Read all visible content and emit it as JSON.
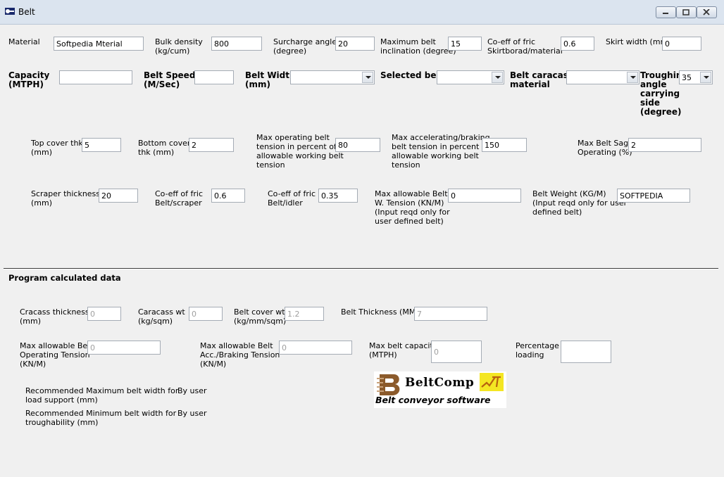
{
  "window": {
    "title": "Belt"
  },
  "row1": {
    "material": {
      "label": "Material",
      "value": "Softpedia Mterial"
    },
    "bulk_density": {
      "label": "Bulk density\n(kg/cum)",
      "value": "800"
    },
    "surcharge_angle": {
      "label": "Surcharge angle\n(degree)",
      "value": "20"
    },
    "max_belt_inclination": {
      "label": "Maximum belt\ninclination (degree)",
      "value": "15"
    },
    "coeff_fric_skirtboard": {
      "label": "Co-eff of fric\nSkirtborad/material",
      "value": "0.6"
    },
    "skirt_width": {
      "label": "Skirt width (mm)",
      "value": "0"
    }
  },
  "row2": {
    "capacity": {
      "label": "Capacity\n(MTPH)",
      "value": ""
    },
    "belt_speed": {
      "label": "Belt Speed\n(M/Sec)",
      "value": ""
    },
    "belt_width": {
      "label": "Belt Width\n(mm)",
      "value": ""
    },
    "selected_belt": {
      "label": "Selected belt",
      "value": ""
    },
    "belt_carcass": {
      "label": "Belt caracass\nmaterial",
      "value": ""
    },
    "troughing_angle": {
      "label": "Troughin\nangle\ncarrying\nside\n(degree)",
      "value": "35"
    }
  },
  "row3": {
    "top_cover": {
      "label": "Top cover thk\n(mm)",
      "value": "5"
    },
    "bottom_cover": {
      "label": "Bottom cover\nthk (mm)",
      "value": "2"
    },
    "max_operating_tension": {
      "label": "Max operating belt\ntension in percent of\nallowable working belt\ntension",
      "value": "80"
    },
    "max_accel_tension": {
      "label": "Max accelerating/braking\nbelt tension in percent of\nallowable working belt\ntension",
      "value": "150"
    },
    "max_belt_sag": {
      "label": "Max Belt Sag\nOperating (%)",
      "value": "2"
    }
  },
  "row4": {
    "scraper_thickness": {
      "label": "Scraper thickness\n(mm)",
      "value": "20"
    },
    "coeff_fric_scraper": {
      "label": "Co-eff of fric\nBelt/scraper",
      "value": "0.6"
    },
    "coeff_fric_idler": {
      "label": "Co-eff of fric\nBelt/idler",
      "value": "0.35"
    },
    "max_allowable_w_tension": {
      "label": "Max allowable Belt\nW. Tension (KN/M)\n(Input reqd only for\nuser defined belt)",
      "value": "0"
    },
    "belt_weight": {
      "label": "Belt Weight (KG/M)\n(Input reqd only for user\ndefined belt)",
      "value": "SOFTPEDIA"
    }
  },
  "calculated": {
    "heading": "Program calculated data",
    "carcass_thickness": {
      "label": "Cracass thickness\n(mm)",
      "value": "0"
    },
    "carcass_wt": {
      "label": "Caracass wt\n(kg/sqm)",
      "value": "0"
    },
    "belt_cover_wt": {
      "label": "Belt cover wt\n(kg/mm/sqm)",
      "value": "1.2"
    },
    "belt_thickness": {
      "label": "Belt Thickness (MM)",
      "value": "7"
    },
    "max_allow_operating_tension": {
      "label": "Max allowable Belt\nOperating Tension\n(KN/M)",
      "value": "0"
    },
    "max_allow_accel_tension": {
      "label": "Max allowable Belt\nAcc./Braking Tension\n(KN/M)",
      "value": "0"
    },
    "max_belt_capacity": {
      "label": "Max belt capacity\n(MTPH)",
      "value": "0"
    },
    "percentage_loading": {
      "label": "Percentage\nloading",
      "value": ""
    },
    "rec_max_width": {
      "label": "Recommended Maximum belt width for\nload support (mm)",
      "value": "By user"
    },
    "rec_min_width": {
      "label": "Recommended Minimum belt width for\ntroughability (mm)",
      "value": "By user"
    }
  },
  "logo": {
    "name": "BeltComp",
    "tagline": "Belt conveyor software"
  },
  "colors": {
    "titlebar": "#dbe4ef",
    "window_bg": "#f0f0f0",
    "logo_accent": "#f4e623",
    "logo_brown": "#8b5a2b"
  }
}
